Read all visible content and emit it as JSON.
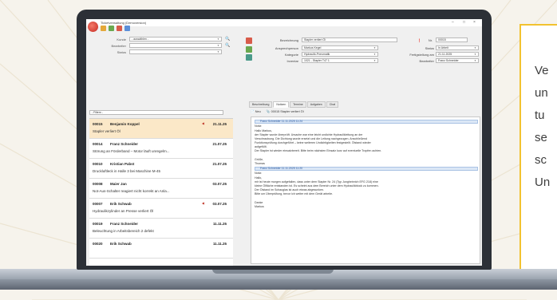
{
  "window": {
    "title": "Ticketverwaltung (Demoversion)",
    "controls": [
      "–",
      "□",
      "×"
    ]
  },
  "toolbar": {
    "icons": [
      "new-ticket-icon",
      "refresh-icon",
      "chart-icon",
      "search-icon"
    ]
  },
  "filter": {
    "kunde_label": "Kunde",
    "kunde_value": "- auswählen -",
    "bearbeiter_label": "Bearbeiter",
    "bearbeiter_value": "",
    "status_label": "Status",
    "status_value": "",
    "list_filter_value": "- Filtern -"
  },
  "tickets": [
    {
      "number": "00015",
      "name": "Benjamin Koppel",
      "date": "21.11.25",
      "desc": "Stapler verliert Öl",
      "flagged": true
    },
    {
      "number": "00014",
      "name": "Franz Schneider",
      "date": "21.07.25",
      "desc": "Störung an Förderband – Motor läuft unregelm...",
      "flagged": false
    },
    {
      "number": "00010",
      "name": "Kristian Pabst",
      "date": "21.07.25",
      "desc": "Druckluftleck in Halle 3 bei Maschine M-45",
      "flagged": false
    },
    {
      "number": "00008",
      "name": "Maier Jan",
      "date": "03.07.25",
      "desc": "Not-Aus-Schalter reagiert nicht korrekt an Anla...",
      "flagged": false
    },
    {
      "number": "00007",
      "name": "Erik Schwab",
      "date": "03.07.25",
      "desc": "Hydraulikzylinder an Presse verliert Öl",
      "flagged": true
    },
    {
      "number": "00019",
      "name": "Franz Schneider",
      "date": "11.11.25",
      "desc": "Beleuchtung in Arbeitsbereich 2 defekt",
      "flagged": false
    },
    {
      "number": "00020",
      "name": "Erik Schwab",
      "date": "11.11.25",
      "desc": "",
      "flagged": false
    }
  ],
  "detail": {
    "bezeichnung_label": "Bezeichnung",
    "bezeichnung_value": "Stapler verliert Öl",
    "nr_label": "Nr.",
    "nr_value": "00015",
    "ansprechperson_label": "Ansprechperson",
    "ansprechperson_value": "Markus Kegel",
    "status_label": "Status",
    "status_value": "In Arbeit",
    "kategorie_label": "Kategorie",
    "kategorie_value": "Hydraulik-Pneumatik",
    "faelligkeit_label": "Fertigstellung am",
    "faelligkeit_value": "21.11.2025",
    "inventar_label": "Inventar",
    "inventar_value": "1021 - Stapler T47 1",
    "bearbeiter_label": "Bearbeiter",
    "bearbeiter_value": "Franz Schneider"
  },
  "tabs": [
    "Beschreibung",
    "Notizen",
    "Termine",
    "Aufgaben",
    "Chat"
  ],
  "notes_toolbar": {
    "new_label": "Neu",
    "ref_label": "00015 Stapler verliert Öl"
  },
  "notes": [
    {
      "header": "Franz Schneider 11.11.2025 11:24",
      "lines": [
        "Notiz:",
        "Hallo Markus,",
        "der Stapler wurde überprüft. Ursache war eine leicht undichte Hydraulikleitung an der",
        "Verschraubung. Die Dichtung wurde ersetzt und die Leitung nachgezogen. Anschließend",
        "Funktionsprüfung durchgeführt – keine weiteren Undichtigkeiten festgestellt. Ölstand wieder",
        "aufgefüllt.",
        "Der Stapler ist wieder einsatzbereit. Bitte beim nächsten Einsatz kurz auf eventuelle Tropfen achten.",
        "",
        "Grüße,",
        "Thomas"
      ]
    },
    {
      "header": "Franz Schneider 11.11.2025 11:20",
      "lines": [
        "Notiz:",
        "Hallo,",
        "mir ist heute morgen aufgefallen, dass unter dem Stapler Nr. 24 (Typ Jungheinrich EFG 218) eine",
        "kleine Ölfläche entstanden ist. Es scheint aus dem Bereich unter dem Hydraulikblock zu kommen.",
        "Der Ölstand im Schauglas ist auch etwas abgesunken.",
        "Bitte um Überprüfung, bevor ich weiter mit dem Gerät arbeite.",
        "",
        "Danke",
        "Markus"
      ]
    }
  ],
  "callout": {
    "lines": [
      "Ve",
      "un",
      "tu",
      "se",
      "sc",
      "Un"
    ]
  },
  "colors": {
    "accent_yellow": "#f2c230",
    "selected_row": "#fbe8c8",
    "bezel": "#2c3037",
    "flag_red": "#c0392b"
  }
}
